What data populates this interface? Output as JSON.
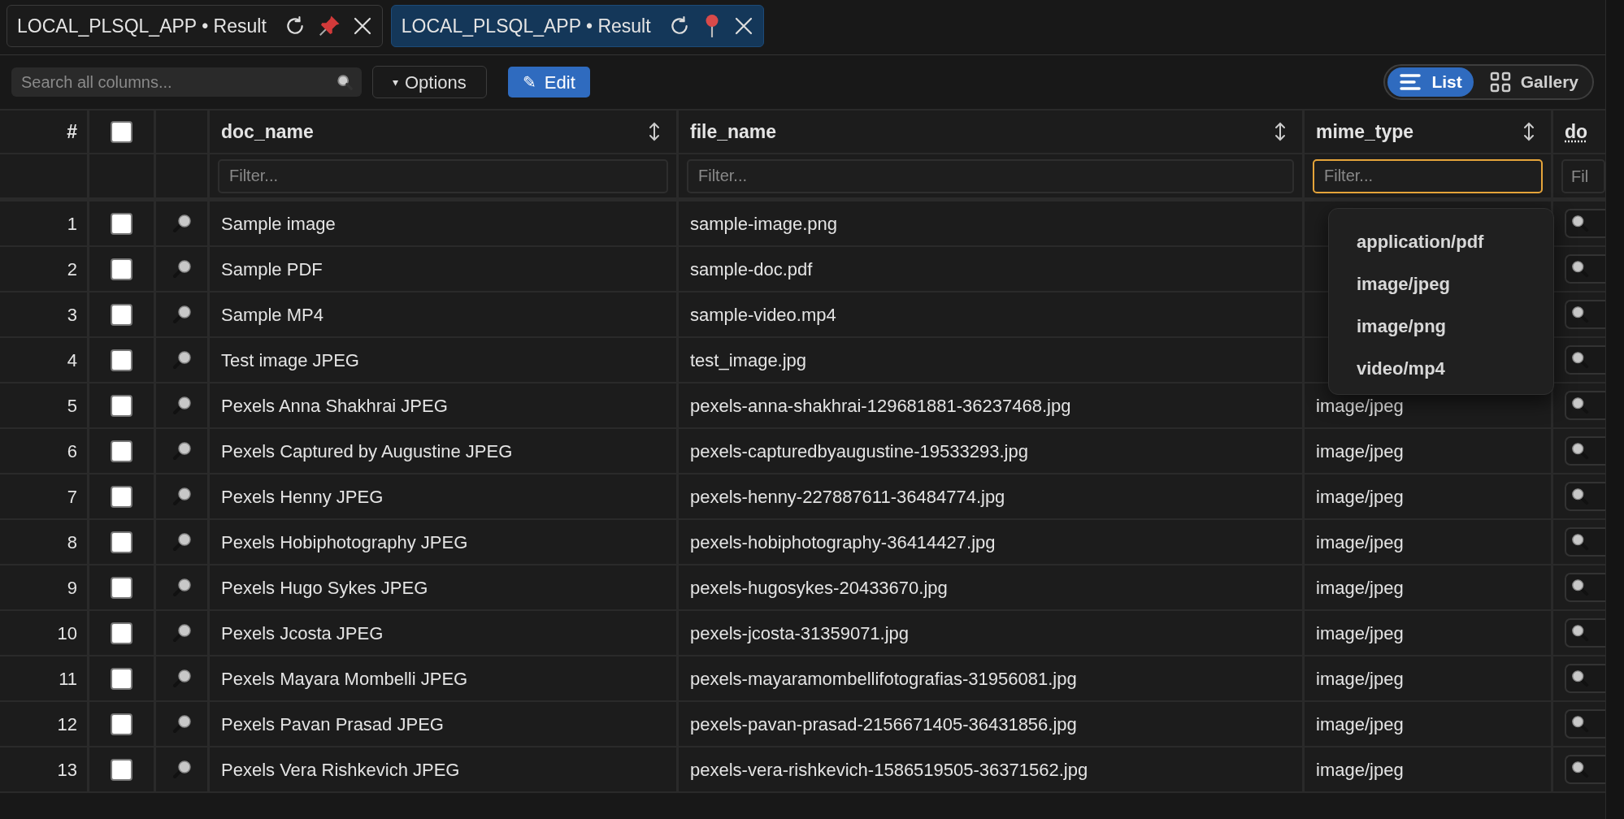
{
  "tabs": [
    {
      "label": "LOCAL_PLSQL_APP • Result",
      "selected": false
    },
    {
      "label": "LOCAL_PLSQL_APP • Result",
      "selected": true
    }
  ],
  "toolbar": {
    "search": {
      "placeholder": "Search all columns..."
    },
    "options_button": "Options",
    "options_caret": "▾",
    "edit_button": "Edit",
    "edit_glyph": "✎",
    "views": [
      {
        "label": "List",
        "kind": "list",
        "selected": true
      },
      {
        "label": "Gallery",
        "kind": "gallery",
        "selected": false
      }
    ]
  },
  "table": {
    "number_heading": "#",
    "select_all": {
      "checked": false
    },
    "columns": [
      {
        "label": "doc_name",
        "placeholder": "Filter...",
        "focused": false
      },
      {
        "label": "file_name",
        "placeholder": "Filter...",
        "focused": false
      },
      {
        "label": "mime_type",
        "placeholder": "Filter...",
        "focused": true
      }
    ],
    "cut_column": {
      "label": "do",
      "placeholder": "Fil"
    },
    "rows": [
      {
        "number": "1",
        "checked": false,
        "doc_name": "Sample image",
        "file_name": "sample-image.png"
      },
      {
        "number": "2",
        "checked": false,
        "doc_name": "Sample PDF",
        "file_name": "sample-doc.pdf"
      },
      {
        "number": "3",
        "checked": false,
        "doc_name": "Sample MP4",
        "file_name": "sample-video.mp4"
      },
      {
        "number": "4",
        "checked": false,
        "doc_name": "Test image JPEG",
        "file_name": "test_image.jpg"
      },
      {
        "number": "5",
        "checked": false,
        "doc_name": "Pexels Anna Shakhrai JPEG",
        "file_name": "pexels-anna-shakhrai-129681881-36237468.jpg",
        "mime_type": "image/jpeg"
      },
      {
        "number": "6",
        "checked": false,
        "doc_name": "Pexels Captured by Augustine JPEG",
        "file_name": "pexels-capturedbyaugustine-19533293.jpg",
        "mime_type": "image/jpeg"
      },
      {
        "number": "7",
        "checked": false,
        "doc_name": "Pexels Henny JPEG",
        "file_name": "pexels-henny-227887611-36484774.jpg",
        "mime_type": "image/jpeg"
      },
      {
        "number": "8",
        "checked": false,
        "doc_name": "Pexels Hobiphotography JPEG",
        "file_name": "pexels-hobiphotography-36414427.jpg",
        "mime_type": "image/jpeg"
      },
      {
        "number": "9",
        "checked": false,
        "doc_name": "Pexels Hugo Sykes JPEG",
        "file_name": "pexels-hugosykes-20433670.jpg",
        "mime_type": "image/jpeg"
      },
      {
        "number": "10",
        "checked": false,
        "doc_name": "Pexels Jcosta JPEG",
        "file_name": "pexels-jcosta-31359071.jpg",
        "mime_type": "image/jpeg"
      },
      {
        "number": "11",
        "checked": false,
        "doc_name": "Pexels Mayara Mombelli JPEG",
        "file_name": "pexels-mayaramombellifotografias-31956081.jpg",
        "mime_type": "image/jpeg"
      },
      {
        "number": "12",
        "checked": false,
        "doc_name": "Pexels Pavan Prasad JPEG",
        "file_name": "pexels-pavan-prasad-2156671405-36431856.jpg",
        "mime_type": "image/jpeg"
      },
      {
        "number": "13",
        "checked": false,
        "doc_name": "Pexels Vera Rishkevich JPEG",
        "file_name": "pexels-vera-rishkevich-1586519505-36371562.jpg",
        "mime_type": "image/jpeg"
      }
    ]
  },
  "filter_suggestions": [
    "application/pdf",
    "image/jpeg",
    "image/png",
    "video/mp4"
  ]
}
